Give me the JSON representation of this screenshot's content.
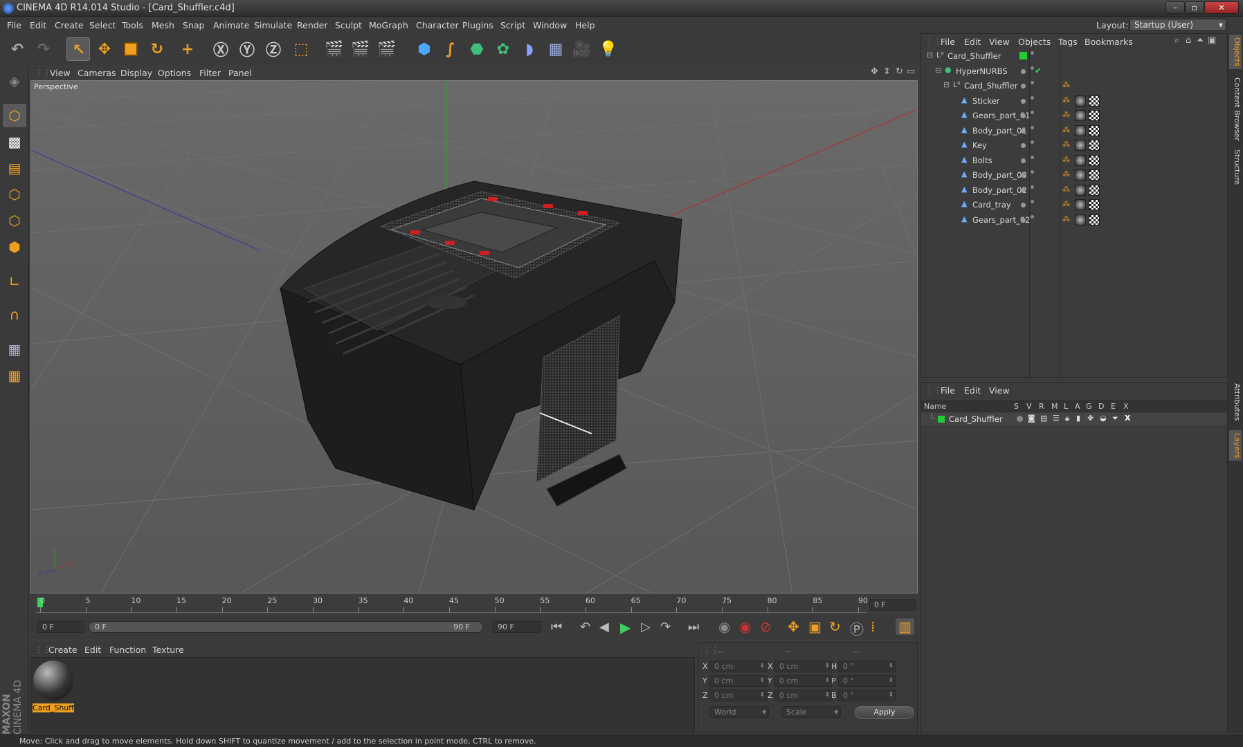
{
  "titlebar": {
    "title": "CINEMA 4D R14.014 Studio - [Card_Shuffler.c4d]"
  },
  "menubar": {
    "items": [
      "File",
      "Edit",
      "Create",
      "Select",
      "Tools",
      "Mesh",
      "Snap",
      "Animate",
      "Simulate",
      "Render",
      "Sculpt",
      "MoGraph",
      "Character",
      "Plugins",
      "Script",
      "Window",
      "Help"
    ],
    "layout_label": "Layout:",
    "layout_value": "Startup (User)"
  },
  "viewport": {
    "menu": [
      "View",
      "Cameras",
      "Display",
      "Options",
      "Filter",
      "Panel"
    ],
    "label": "Perspective",
    "axis_labels": {
      "y": "Y",
      "x": "X",
      "z": "Z"
    }
  },
  "timeline": {
    "ticks": [
      "0",
      "5",
      "10",
      "15",
      "20",
      "25",
      "30",
      "35",
      "40",
      "45",
      "50",
      "55",
      "60",
      "65",
      "70",
      "75",
      "80",
      "85",
      "90"
    ],
    "current_frame": "0 F"
  },
  "transport": {
    "start_field": "0 F",
    "range_left": "0 F",
    "range_right": "90 F",
    "end_field": "90 F"
  },
  "material_manager": {
    "menu": [
      "Create",
      "Edit",
      "Function",
      "Texture"
    ],
    "material_name": "Card_Shuff"
  },
  "coordinates": {
    "headers": [
      "--",
      "--",
      "--"
    ],
    "rows": [
      {
        "l1": "X",
        "v1": "0 cm",
        "l2": "X",
        "v2": "0 cm",
        "l3": "H",
        "v3": "0 °"
      },
      {
        "l1": "Y",
        "v1": "0 cm",
        "l2": "Y",
        "v2": "0 cm",
        "l3": "P",
        "v3": "0 °"
      },
      {
        "l1": "Z",
        "v1": "0 cm",
        "l2": "Z",
        "v2": "0 cm",
        "l3": "B",
        "v3": "0 °"
      }
    ],
    "world": "World",
    "scale": "Scale",
    "apply": "Apply"
  },
  "object_manager": {
    "menu": [
      "File",
      "Edit",
      "View",
      "Objects",
      "Tags",
      "Bookmarks"
    ],
    "objects": [
      {
        "name": "Card_Shuffler",
        "indent": 0,
        "kind": "null"
      },
      {
        "name": "HyperNURBS",
        "indent": 1,
        "kind": "nurbs"
      },
      {
        "name": "Card_Shuffler",
        "indent": 2,
        "kind": "null"
      },
      {
        "name": "Sticker",
        "indent": 3,
        "kind": "poly"
      },
      {
        "name": "Gears_part_01",
        "indent": 3,
        "kind": "poly"
      },
      {
        "name": "Body_part_01",
        "indent": 3,
        "kind": "poly"
      },
      {
        "name": "Key",
        "indent": 3,
        "kind": "poly"
      },
      {
        "name": "Bolts",
        "indent": 3,
        "kind": "poly"
      },
      {
        "name": "Body_part_03",
        "indent": 3,
        "kind": "poly"
      },
      {
        "name": "Body_part_02",
        "indent": 3,
        "kind": "poly"
      },
      {
        "name": "Card_tray",
        "indent": 3,
        "kind": "poly"
      },
      {
        "name": "Gears_part_02",
        "indent": 3,
        "kind": "poly"
      }
    ]
  },
  "layer_manager": {
    "menu": [
      "File",
      "Edit",
      "View"
    ],
    "columns": [
      "Name",
      "S",
      "V",
      "R",
      "M",
      "L",
      "A",
      "G",
      "D",
      "E",
      "X"
    ],
    "layers": [
      {
        "name": "Card_Shuffler",
        "color": "#22cc33"
      }
    ]
  },
  "sidetabs": [
    "Objects",
    "Content Browser",
    "Structure",
    "Attributes",
    "Layers"
  ],
  "status": "Move: Click and drag to move elements. Hold down SHIFT to quantize movement / add to the selection in point mode, CTRL to remove.",
  "brand": {
    "maxon": "MAXON",
    "cinema": "CINEMA 4D"
  },
  "colors": {
    "accent": "#f0a020",
    "panel": "#3c3c3c",
    "viewport": "#5d5d5d",
    "green": "#22cc33"
  }
}
